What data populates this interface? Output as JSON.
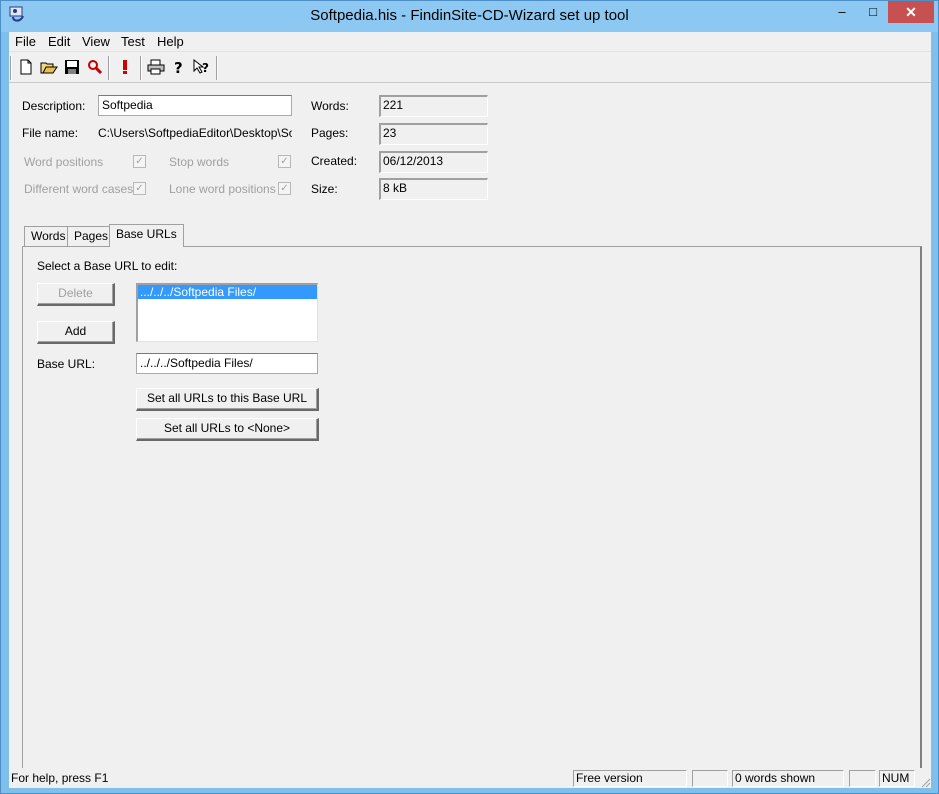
{
  "window": {
    "title": "Softpedia.his - FindinSite-CD-Wizard set up tool",
    "minimize": "–",
    "maximize": "□",
    "close": "✕"
  },
  "menu": {
    "items": [
      "File",
      "Edit",
      "View",
      "Test",
      "Help"
    ]
  },
  "toolbar": {
    "icons": [
      "new-document-icon",
      "open-folder-icon",
      "save-icon",
      "search-icon",
      "run-icon",
      "print-icon",
      "help-icon",
      "context-help-icon"
    ]
  },
  "form": {
    "description_label": "Description:",
    "description_value": "Softpedia",
    "filename_label": "File name:",
    "filename_value": "C:\\Users\\SoftpediaEditor\\Desktop\\Softp",
    "word_positions": "Word positions",
    "stop_words": "Stop words",
    "different_cases": "Different word cases",
    "lone_positions": "Lone word positions",
    "words_label": "Words:",
    "words_value": "221",
    "pages_label": "Pages:",
    "pages_value": "23",
    "created_label": "Created:",
    "created_value": "06/12/2013",
    "size_label": "Size:",
    "size_value": "8 kB"
  },
  "tabs": [
    "Words",
    "Pages",
    "Base URLs"
  ],
  "base_urls": {
    "prompt": "Select a Base URL to edit:",
    "delete": "Delete",
    "add": "Add",
    "list": [
      ".../../../Softpedia Files/"
    ],
    "base_url_label": "Base URL:",
    "base_url_value": "../../../Softpedia Files/",
    "set_all": "Set all URLs to this Base URL",
    "set_none": "Set all URLs to <None>"
  },
  "status": {
    "help": "For help, press F1",
    "version": "Free version",
    "empty1": "",
    "words_shown": "0 words shown",
    "empty2": "",
    "num": "NUM"
  }
}
